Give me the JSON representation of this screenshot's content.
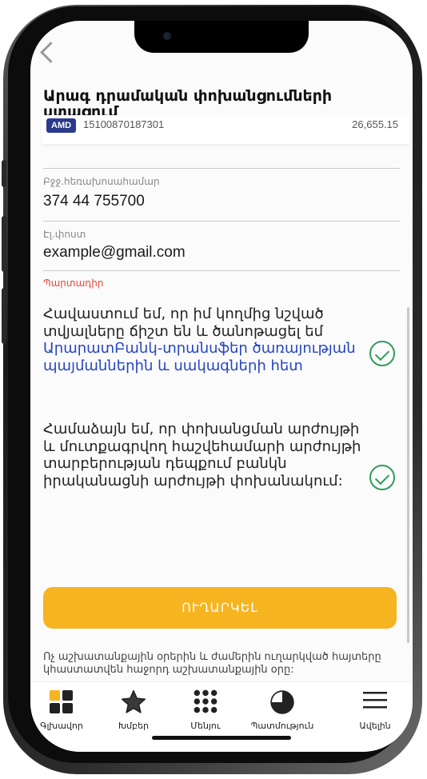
{
  "header": {
    "back_label": "back",
    "title": "Արագ դրամական փոխանցումների ստացում"
  },
  "account": {
    "currency": "AMD",
    "number": "15100870187301",
    "amount": "26,655.15"
  },
  "fields": {
    "phone_label": "Բջջ.հեռախոսահամար",
    "phone_value": "374 44 755700",
    "email_label": "Էլ.փոստ",
    "email_value": "example@gmail.com",
    "signature_label": "Պարտադիր"
  },
  "consents": [
    {
      "text": "Հավաստում եմ, որ իմ կողմից նշված տվյալները ճիշտ են և ծանոթացել եմ ",
      "link": "ԱրարատԲանկ-տրանսֆեր ծառայության պայմաններին և սակագների հետ",
      "checked": true
    },
    {
      "text": "Համաձայն եմ, որ փոխանցման արժույթի և մուտքագրվող հաշվեհամարի արժույթի տարբերության դեպքում բանկն իրականացնի արժույթի փոխանակում:",
      "checked": true
    }
  ],
  "send_button": "ՈՒՂԱՐԿԵԼ",
  "footnote": "Ոչ աշխատանքային օրերին և ժամերին ուղարկված հայտերը կհաստատվեն հաջորդ աշխատանքային օրը:",
  "tabs": [
    {
      "label": "Գլխավոր",
      "icon": "home-grid-icon"
    },
    {
      "label": "Խմբեր",
      "icon": "star-icon"
    },
    {
      "label": "Մենյու",
      "icon": "menu-dots-icon"
    },
    {
      "label": "Պատմություն",
      "icon": "history-pie-icon"
    },
    {
      "label": "Ավելին",
      "icon": "hamburger-icon"
    }
  ],
  "colors": {
    "accent": "#f6b421",
    "link": "#2545c4",
    "check": "#2e9e5b",
    "required": "#e04a3a",
    "badge": "#2a3a8c"
  }
}
